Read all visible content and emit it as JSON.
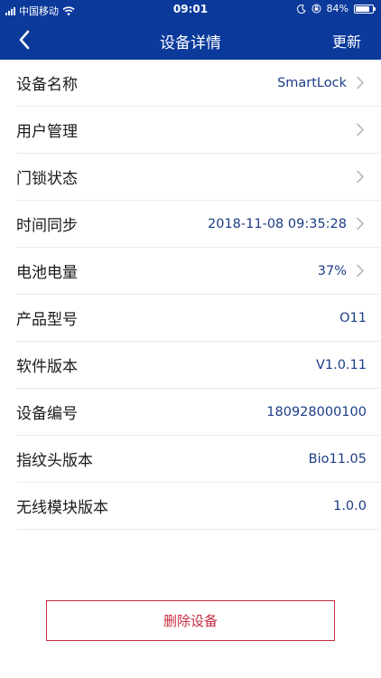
{
  "status_bar": {
    "carrier": "中国移动",
    "time": "09:01",
    "battery_pct": "84%",
    "battery_level": 0.84,
    "icons": [
      "signal-icon",
      "wifi-icon",
      "moon-icon",
      "rotation-lock-icon",
      "battery-icon"
    ]
  },
  "nav": {
    "title": "设备详情",
    "action": "更新",
    "back_icon": "chevron-left-icon"
  },
  "rows": [
    {
      "label": "设备名称",
      "value": "SmartLock",
      "chevron": true
    },
    {
      "label": "用户管理",
      "value": "",
      "chevron": true
    },
    {
      "label": "门锁状态",
      "value": "",
      "chevron": true
    },
    {
      "label": "时间同步",
      "value": "2018-11-08 09:35:28",
      "chevron": true
    },
    {
      "label": "电池电量",
      "value": "37%",
      "chevron": true
    },
    {
      "label": "产品型号",
      "value": "O11",
      "chevron": false
    },
    {
      "label": "软件版本",
      "value": "V1.0.11",
      "chevron": false
    },
    {
      "label": "设备编号",
      "value": "180928000100",
      "chevron": false
    },
    {
      "label": "指纹头版本",
      "value": "Bio11.05",
      "chevron": false
    },
    {
      "label": "无线模块版本",
      "value": "1.0.0",
      "chevron": false
    }
  ],
  "delete_button": "删除设备",
  "colors": {
    "header": "#0b3a9b",
    "value_text": "#1c3d87",
    "danger": "#c62c40"
  }
}
